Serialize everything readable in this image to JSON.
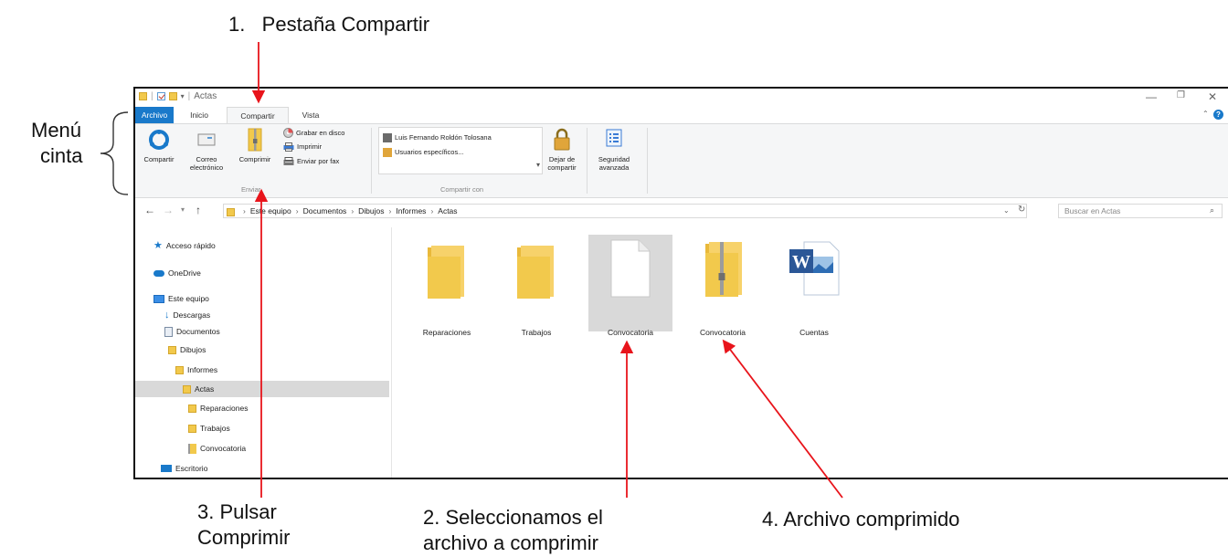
{
  "annotations": {
    "a1": "1.   Pestaña Compartir",
    "menu_line1": "Menú",
    "menu_line2": "cinta",
    "a3_line1": "3. Pulsar",
    "a3_line2": "Comprimir",
    "a2_line1": "2. Seleccionamos el",
    "a2_line2": "archivo a comprimir",
    "a4": "4. Archivo comprimido"
  },
  "window": {
    "title": "Actas",
    "tabs": [
      "Archivo",
      "Inicio",
      "Compartir",
      "Vista"
    ],
    "ribbon": {
      "compartir": "Compartir",
      "correo_l1": "Correo",
      "correo_l2": "electrónico",
      "comprimir": "Comprimir",
      "grabar": "Grabar en disco",
      "imprimir": "Imprimir",
      "fax": "Enviar por fax",
      "enviar_group": "Enviar",
      "share_user": "Luis Fernando Roldón Tolosana",
      "share_specific": "Usuarios específicos...",
      "compartir_con_group": "Compartir con",
      "dejar_l1": "Dejar de",
      "dejar_l2": "compartir",
      "seg_l1": "Seguridad",
      "seg_l2": "avanzada"
    },
    "breadcrumb": [
      "Este equipo",
      "Documentos",
      "Dibujos",
      "Informes",
      "Actas"
    ],
    "search_placeholder": "Buscar en Actas",
    "nav": {
      "quick": "Acceso rápido",
      "onedrive": "OneDrive",
      "thispc": "Este equipo",
      "descargas": "Descargas",
      "documentos": "Documentos",
      "dibujos": "Dibujos",
      "informes": "Informes",
      "actas": "Actas",
      "reparaciones": "Reparaciones",
      "trabajos": "Trabajos",
      "convocatoria": "Convocatoria",
      "escritorio": "Escritorio"
    },
    "items": [
      "Reparaciones",
      "Trabajos",
      "Convocatoria",
      "Convocatoria",
      "Cuentas"
    ]
  },
  "colors": {
    "arrow": "#e8141b",
    "file_tab": "#1979ca",
    "folder": "#f2c94c"
  }
}
